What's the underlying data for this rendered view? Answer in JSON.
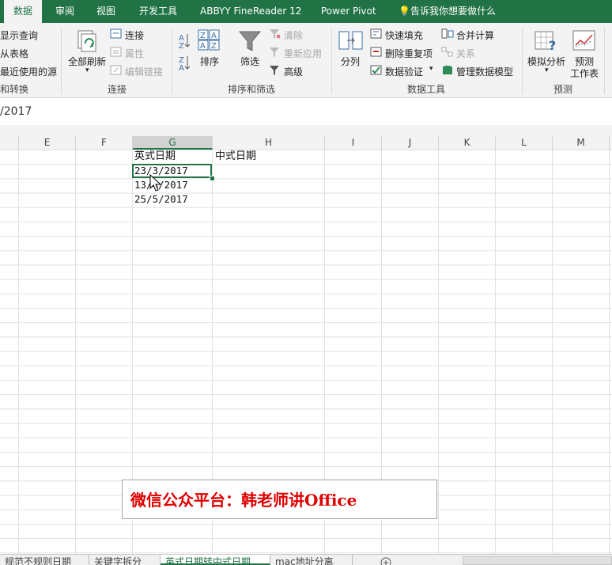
{
  "ribbon_tabs": [
    {
      "label": "数据",
      "active": true
    },
    {
      "label": "审阅"
    },
    {
      "label": "视图"
    },
    {
      "label": "开发工具"
    },
    {
      "label": "ABBYY FineReader 12"
    },
    {
      "label": "Power Pivot"
    },
    {
      "label": "告诉我你想要做什么"
    }
  ],
  "ribbon": {
    "get_transform": {
      "show_query": "显示查询",
      "from_table": "从表格",
      "recent_sources": "最近使用的源",
      "group": "和转换"
    },
    "connections": {
      "refresh_all": "全部刷新",
      "connections": "连接",
      "properties": "属性",
      "edit_links": "编辑链接",
      "group": "连接"
    },
    "sort_filter": {
      "sort": "排序",
      "filter": "筛选",
      "clear": "清除",
      "reapply": "重新应用",
      "advanced": "高级",
      "group": "排序和筛选"
    },
    "data_tools": {
      "text_to_columns": "分列",
      "flash_fill": "快速填充",
      "remove_duplicates": "删除重复项",
      "data_validation": "数据验证",
      "consolidate": "合并计算",
      "relationships": "关系",
      "manage_data_model": "管理数据模型",
      "group": "数据工具"
    },
    "forecast": {
      "what_if": "模拟分析",
      "forecast_sheet_line1": "预测",
      "forecast_sheet_line2": "工作表",
      "group": "预测"
    }
  },
  "formula_bar": {
    "text": "/2017"
  },
  "columns": [
    {
      "label": "E"
    },
    {
      "label": "F"
    },
    {
      "label": "G",
      "selected": true
    },
    {
      "label": "H"
    },
    {
      "label": "I"
    },
    {
      "label": "J"
    },
    {
      "label": "K"
    },
    {
      "label": "L"
    },
    {
      "label": "M"
    }
  ],
  "cells": {
    "g1": "英式日期",
    "h1": "中式日期",
    "g2": "23/3/2017",
    "g3": "13/4/2017",
    "g4": "25/5/2017"
  },
  "watermark": "微信公众平台：韩老师讲Office",
  "sheet_tabs": [
    {
      "label": "规范不规则日期"
    },
    {
      "label": "关键字拆分"
    },
    {
      "label": "英式日期转中式日期",
      "active": true
    },
    {
      "label": "mac地址分离"
    }
  ],
  "colors": {
    "accent": "#217346",
    "watermark": "#e00000"
  }
}
